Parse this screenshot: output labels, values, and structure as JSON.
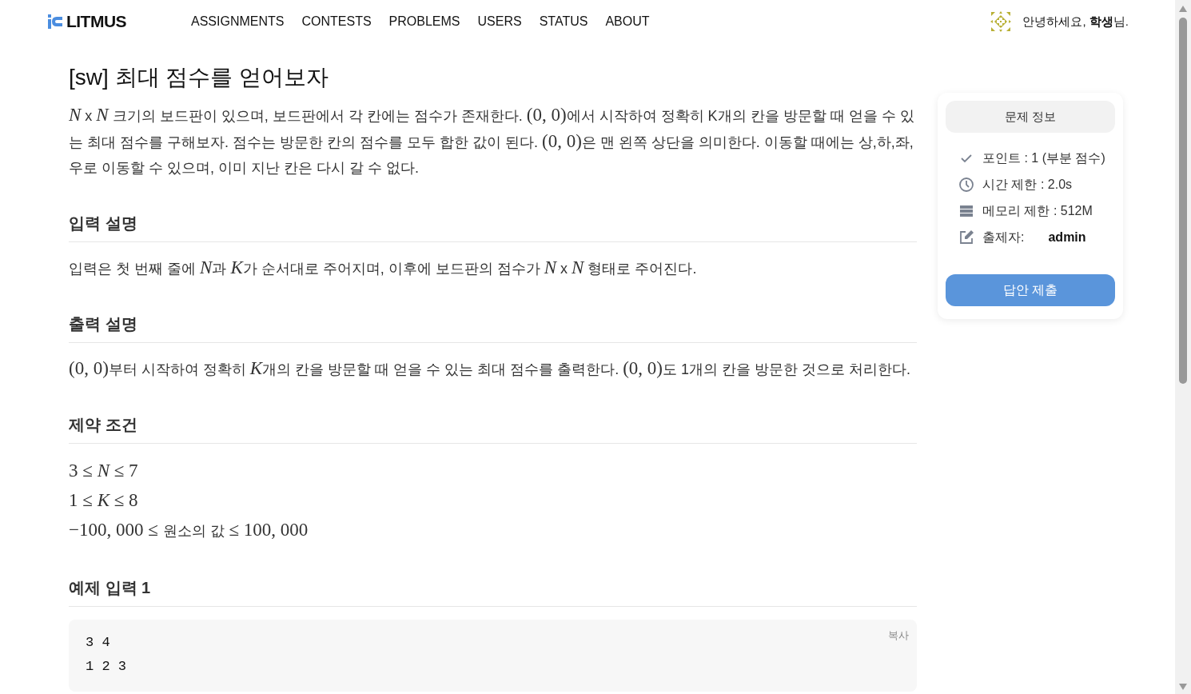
{
  "nav": {
    "logo": "LITMUS",
    "links": [
      "ASSIGNMENTS",
      "CONTESTS",
      "PROBLEMS",
      "USERS",
      "STATUS",
      "ABOUT"
    ],
    "greeting": "안녕하세요, **학생**님."
  },
  "problem": {
    "title": "[sw] 최대 점수를 얻어보자",
    "description": [
      [
        {
          "math": true,
          "text": "*N*"
        },
        {
          "math": false,
          "text": " x "
        },
        {
          "math": true,
          "text": "*N*"
        },
        {
          "math": false,
          "text": " 크기의 보드판이 있으며, 보드판에서 각 칸에는 점수가 존재한다. "
        },
        {
          "math": true,
          "text": "(0, 0)"
        },
        {
          "math": false,
          "text": "에서 시작하여 정확히 K개의 칸을 방문할 때 얻을 수 있는 최대 점수를 구해보자. 점수는 방문한 칸의 점수를 모두 합한 값이 된다. "
        },
        {
          "math": true,
          "text": "(0, 0)"
        },
        {
          "math": false,
          "text": "은 맨 왼쪽 상단을 의미한다. 이동할 때에는 상,하,좌,우로 이동할 수 있으며, 이미 지난 칸은 다시 갈 수 없다."
        }
      ]
    ],
    "sections": [
      {
        "heading": "입력 설명",
        "paragraphs": [
          [
            {
              "math": false,
              "text": "입력은 첫 번째 줄에 "
            },
            {
              "math": true,
              "text": "*N*"
            },
            {
              "math": false,
              "text": "과 "
            },
            {
              "math": true,
              "text": "*K*"
            },
            {
              "math": false,
              "text": "가 순서대로 주어지며, 이후에 보드판의 점수가 "
            },
            {
              "math": true,
              "text": "*N*"
            },
            {
              "math": false,
              "text": " x "
            },
            {
              "math": true,
              "text": "*N*"
            },
            {
              "math": false,
              "text": " 형태로 주어진다."
            }
          ]
        ]
      },
      {
        "heading": "출력 설명",
        "paragraphs": [
          [
            {
              "math": true,
              "text": "(0, 0)"
            },
            {
              "math": false,
              "text": "부터 시작하여 정확히 "
            },
            {
              "math": true,
              "text": "*K*"
            },
            {
              "math": false,
              "text": "개의 칸을 방문할 때 얻을 수 있는 최대 점수를 출력한다. "
            },
            {
              "math": true,
              "text": "(0, 0)"
            },
            {
              "math": false,
              "text": "도 1개의 칸을 방문한 것으로 처리한다."
            }
          ]
        ]
      },
      {
        "heading": "제약 조건",
        "formulas": [
          [
            {
              "math": true,
              "text": "3 ≤ *N* ≤ 7"
            }
          ],
          [
            {
              "math": true,
              "text": "1 ≤ *K* ≤ 8"
            }
          ],
          [
            {
              "math": true,
              "text": "−100, 000 ≤ "
            },
            {
              "math": false,
              "text": "원소의 값"
            },
            {
              "math": true,
              "text": " ≤ 100, 000"
            }
          ]
        ]
      },
      {
        "heading": "예제 입력 1",
        "code": {
          "copy": "복사",
          "lines": [
            "3 4",
            "1 2 3"
          ]
        }
      }
    ]
  },
  "info": {
    "title": "문제 정보",
    "items": [
      {
        "kind": "check",
        "label": "포인트 : 1 (부분 점수)"
      },
      {
        "kind": "clock",
        "label": "시간 제한 : 2.0s"
      },
      {
        "kind": "memory",
        "label": "메모리 제한 : 512M"
      },
      {
        "kind": "author",
        "label": "출제자:",
        "value": "admin"
      }
    ],
    "submit": "답안 제출"
  }
}
